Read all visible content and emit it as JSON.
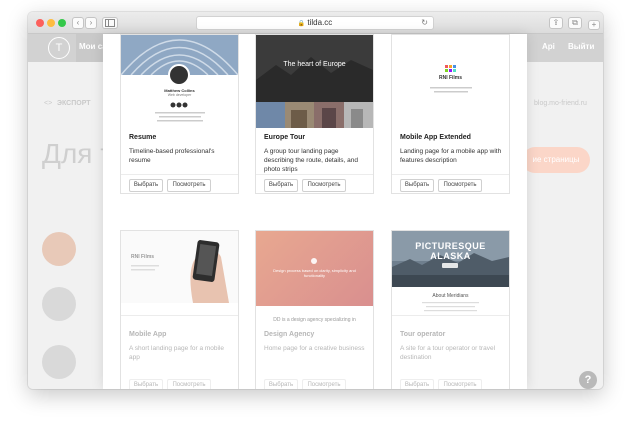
{
  "browser": {
    "url": "tilda.cc",
    "lock_icon": "🔒",
    "reload_icon": "↻",
    "back_icon": "‹",
    "forward_icon": "›",
    "share_icon": "⇪",
    "tabs_icon": "⧉",
    "newtab_icon": "+"
  },
  "site": {
    "logo": "T",
    "nav_active": "Мои са",
    "nav_api": "Api",
    "nav_logout": "Выйти",
    "export": "ЭКСПОРТ",
    "export_icon": "<>",
    "blog": "blog.mo-friend.ru",
    "heading": "Для т",
    "create_button": "ие страницы",
    "help": "?"
  },
  "cards": [
    {
      "title": "Resume",
      "description": "Timeline-based professional's resume",
      "select": "Выбрать",
      "preview": "Посмотреть",
      "thumb": {
        "name": "Matthew Collins",
        "subtitle": "Web developer"
      }
    },
    {
      "title": "Europe Tour",
      "description": "A group tour landing page describing the route, details, and photo strips",
      "select": "Выбрать",
      "preview": "Посмотреть",
      "thumb": {
        "headline": "The heart of Europe"
      }
    },
    {
      "title": "Mobile App Extended",
      "description": "Landing page for a mobile app with features description",
      "select": "Выбрать",
      "preview": "Посмотреть",
      "thumb": {
        "brand": "RNI Films"
      }
    },
    {
      "title": "Mobile App",
      "description": "A short landing page for a mobile app",
      "select": "Выбрать",
      "preview": "Посмотреть",
      "thumb": {
        "brand": "RNI Films"
      }
    },
    {
      "title": "Design Agency",
      "description": "Home page for a creative business",
      "select": "Выбрать",
      "preview": "Посмотреть",
      "thumb": {
        "headline": "Design process based on clarity, simplicity and functionality",
        "tagline": "DD is a design agency specializing in"
      }
    },
    {
      "title": "Tour operator",
      "description": "A site for a tour operator or travel destination",
      "select": "Выбрать",
      "preview": "Посмотреть",
      "thumb": {
        "headline_1": "PICTURESQUE",
        "headline_2": "ALASKA",
        "about": "About Meridians"
      }
    }
  ],
  "colors": {
    "accent_orange": "#f08c6a",
    "nav_gray": "#d2d2d2"
  }
}
